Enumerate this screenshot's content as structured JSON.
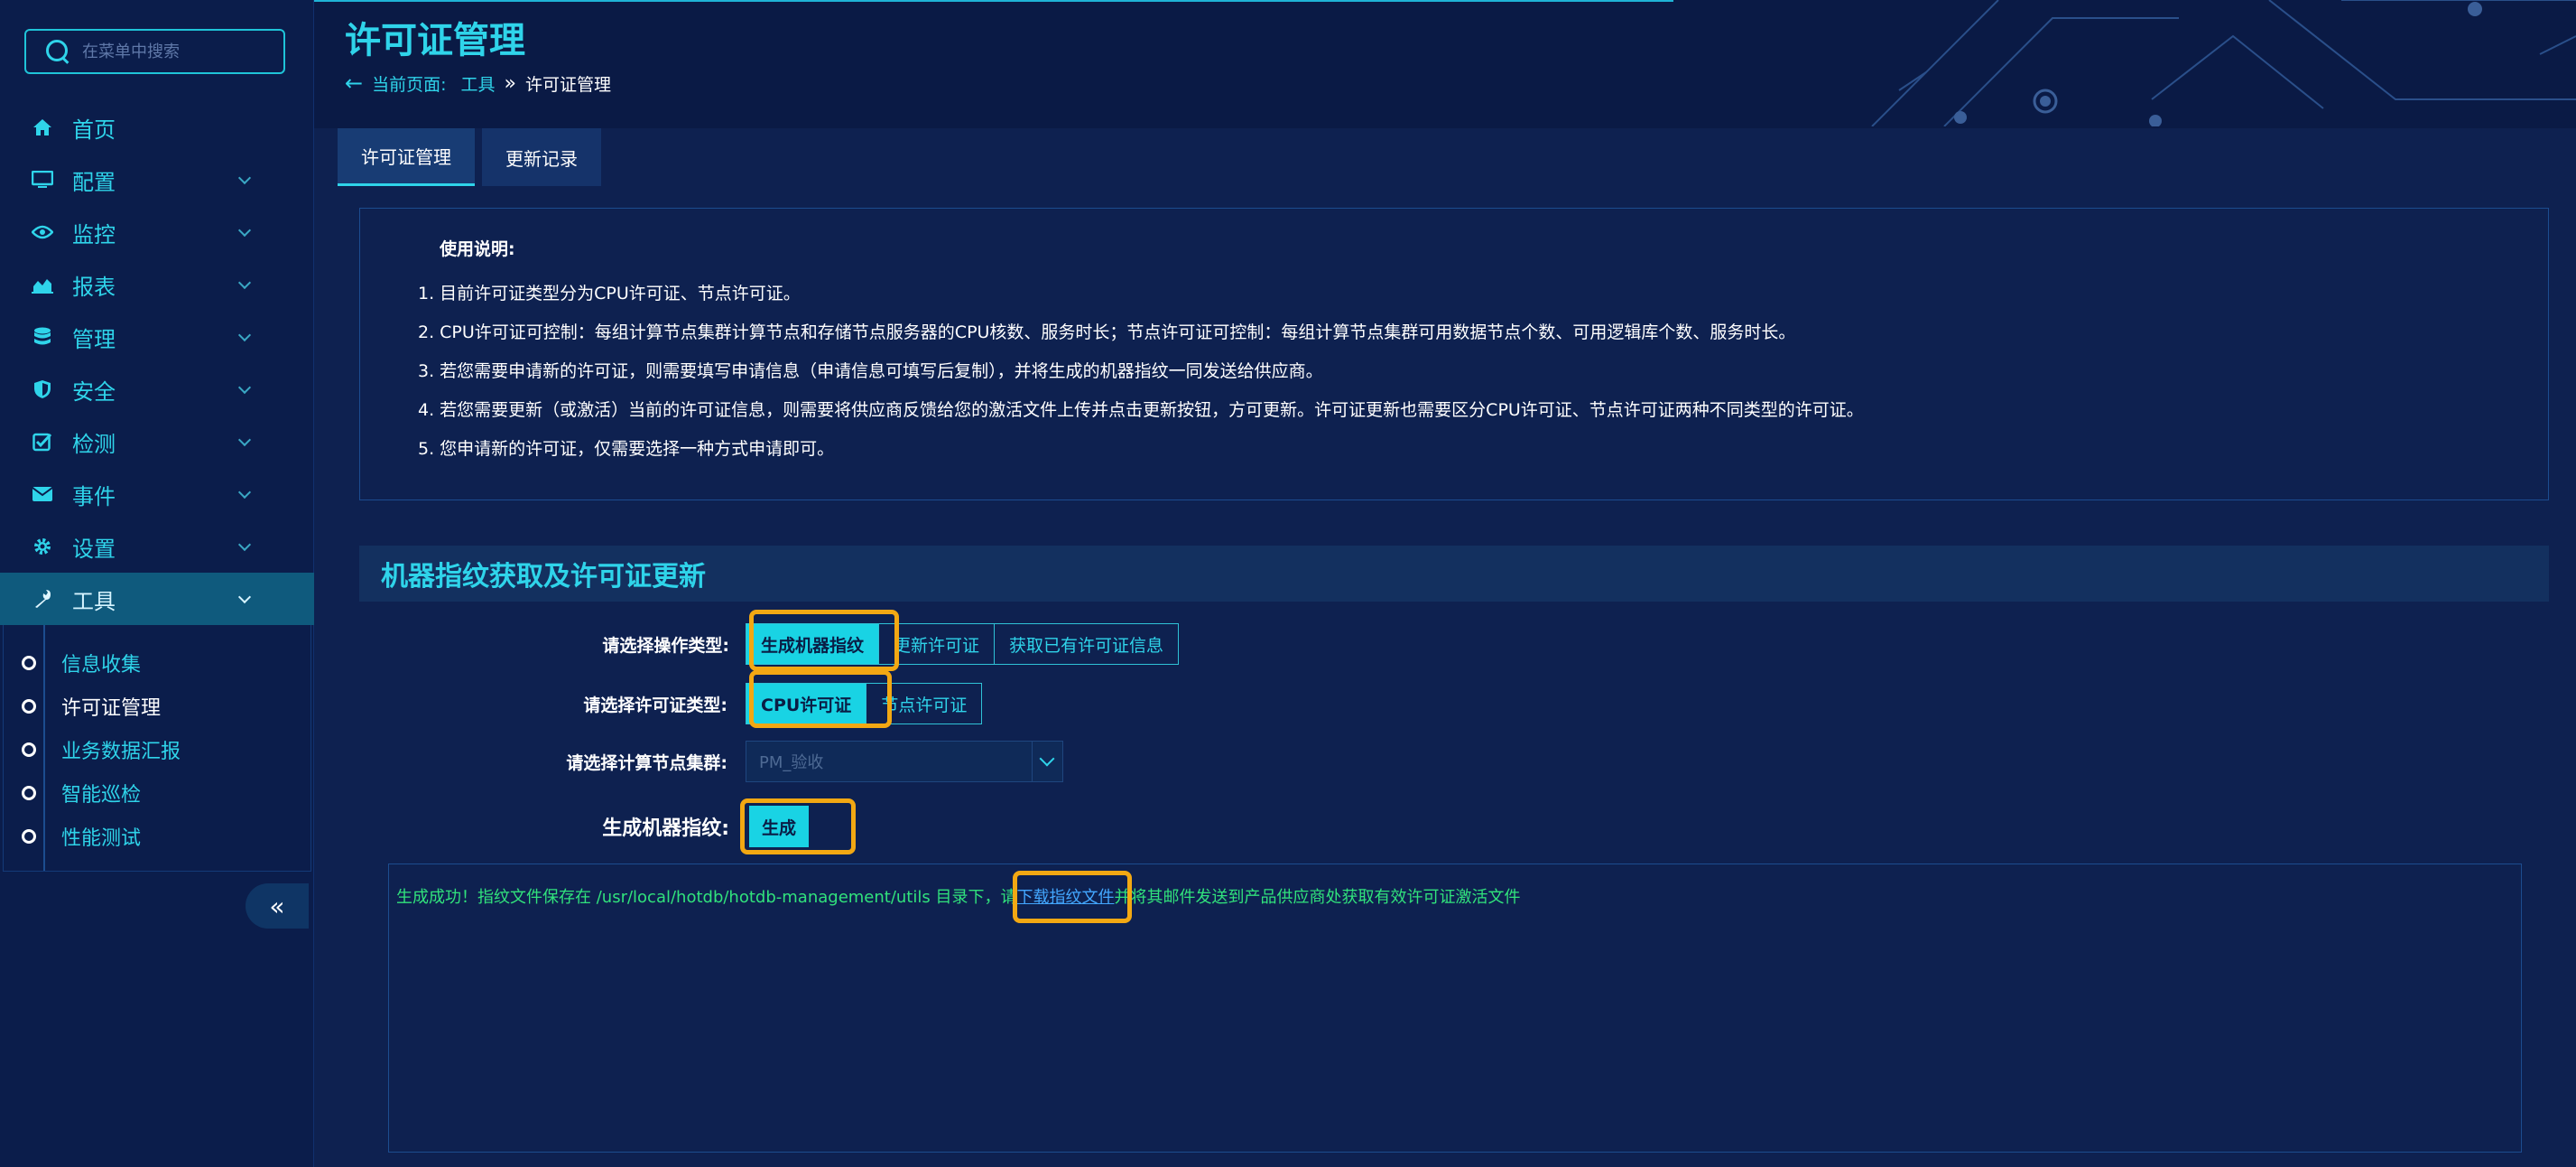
{
  "search": {
    "placeholder": "在菜单中搜索"
  },
  "sidebar": {
    "items": [
      {
        "label": "首页",
        "icon": "home-icon"
      },
      {
        "label": "配置",
        "icon": "monitor-icon"
      },
      {
        "label": "监控",
        "icon": "eye-icon"
      },
      {
        "label": "报表",
        "icon": "area-chart-icon"
      },
      {
        "label": "管理",
        "icon": "database-icon"
      },
      {
        "label": "安全",
        "icon": "shield-icon"
      },
      {
        "label": "检测",
        "icon": "check-square-icon"
      },
      {
        "label": "事件",
        "icon": "envelope-icon"
      },
      {
        "label": "设置",
        "icon": "gear-icon"
      },
      {
        "label": "工具",
        "icon": "wrench-icon"
      }
    ],
    "tools_submenu": [
      {
        "label": "信息收集"
      },
      {
        "label": "许可证管理"
      },
      {
        "label": "业务数据汇报"
      },
      {
        "label": "智能巡检"
      },
      {
        "label": "性能测试"
      }
    ],
    "collapse": "«"
  },
  "page": {
    "title": "许可证管理",
    "breadcrumb_label": "当前页面:",
    "breadcrumb_parent": "工具",
    "breadcrumb_sep": "»",
    "breadcrumb_current": "许可证管理"
  },
  "tabs": [
    {
      "label": "许可证管理"
    },
    {
      "label": "更新记录"
    }
  ],
  "usage": {
    "heading": "使用说明:",
    "lines": [
      "1. 目前许可证类型分为CPU许可证、节点许可证。",
      "2. CPU许可证可控制：每组计算节点集群计算节点和存储节点服务器的CPU核数、服务时长；节点许可证可控制：每组计算节点集群可用数据节点个数、可用逻辑库个数、服务时长。",
      "3. 若您需要申请新的许可证，则需要填写申请信息（申请信息可填写后复制），并将生成的机器指纹一同发送给供应商。",
      "4. 若您需要更新（或激活）当前的许可证信息，则需要将供应商反馈给您的激活文件上传并点击更新按钮，方可更新。许可证更新也需要区分CPU许可证、节点许可证两种不同类型的许可证。",
      "5. 您申请新的许可证，仅需要选择一种方式申请即可。"
    ]
  },
  "section": {
    "title": "机器指纹获取及许可证更新"
  },
  "form": {
    "op_label": "请选择操作类型:",
    "op_options": [
      "生成机器指纹",
      "更新许可证",
      "获取已有许可证信息"
    ],
    "license_label": "请选择许可证类型:",
    "license_options": [
      "CPU许可证",
      "节点许可证"
    ],
    "cluster_label": "请选择计算节点集群:",
    "cluster_value": "PM_验收",
    "gen_label": "生成机器指纹:",
    "gen_button": "生成"
  },
  "result": {
    "prefix": "生成成功！指纹文件保存在 /usr/local/hotdb/hotdb-management/utils 目录下，请",
    "link": "下载指纹文件",
    "suffix": "并将其邮件发送到产品供应商处获取有效许可证激活文件"
  },
  "colors": {
    "accent": "#2fd4ea",
    "highlight": "#f2a813",
    "success": "#31e27c"
  }
}
